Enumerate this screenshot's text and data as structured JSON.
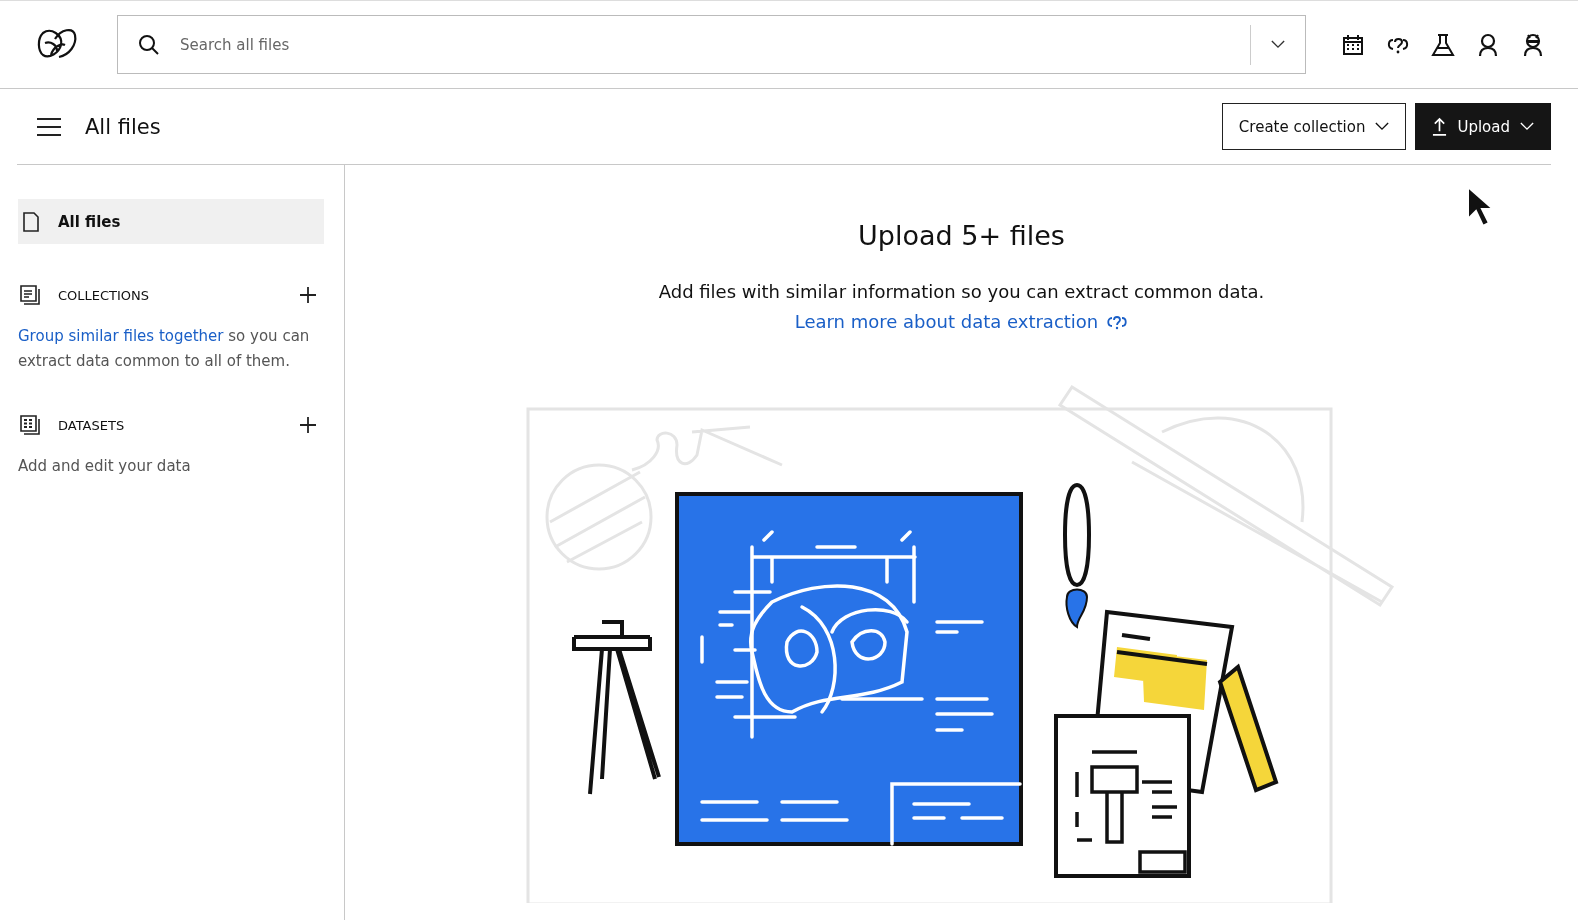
{
  "search": {
    "placeholder": "Search all files"
  },
  "page_title": "All files",
  "buttons": [
    {
      "label": "Create collection",
      "kind": "outline"
    },
    {
      "label": "Upload",
      "kind": "primary"
    }
  ],
  "sidebar": {
    "items": [
      {
        "label": "All files",
        "selected": true
      }
    ],
    "sections": [
      {
        "title": "COLLECTIONS",
        "kind": "collections",
        "link": "Group similar files together",
        "description": "so you can extract data common to all of them."
      },
      {
        "title": "DATASETS",
        "kind": "datasets",
        "description": "Add and edit your data"
      }
    ]
  },
  "empty_state": {
    "title": "Upload 5+ files",
    "message": "Add files with similar information so you can extract common data.",
    "link": "Learn more about data extraction"
  }
}
